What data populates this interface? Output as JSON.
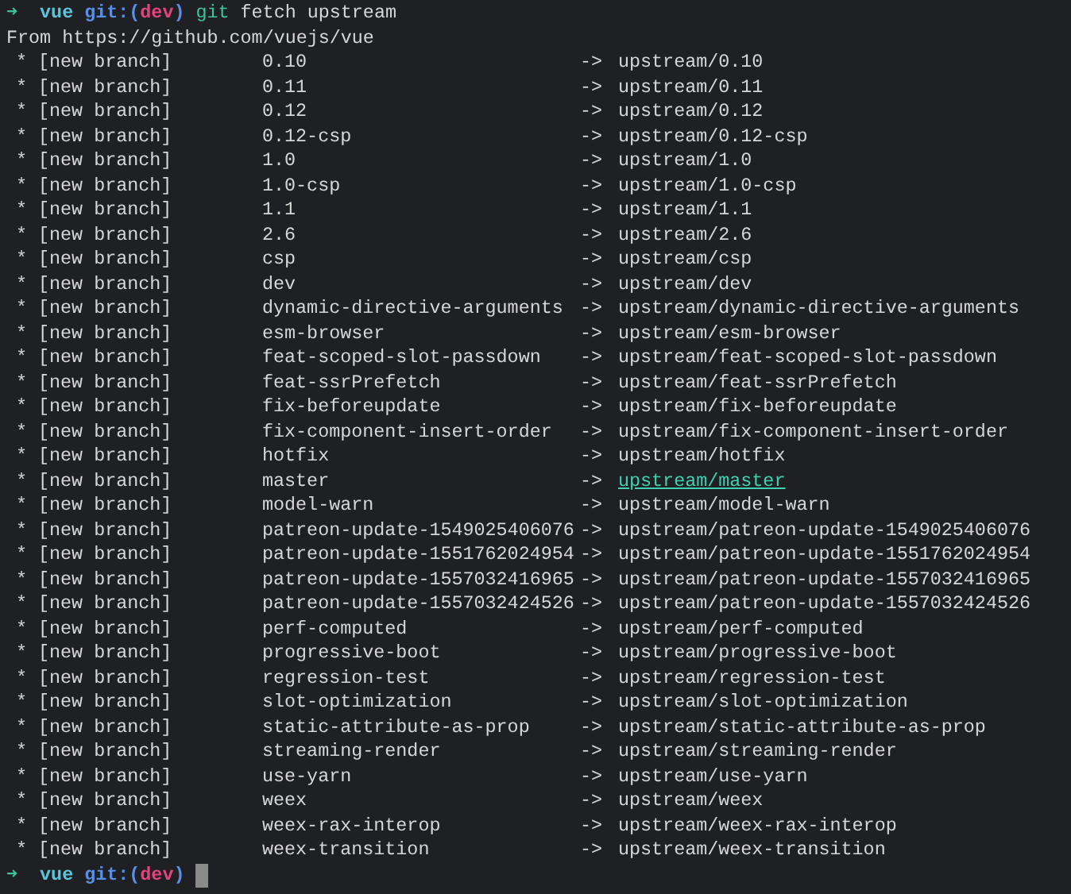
{
  "prompt_top": {
    "arrow": "➜",
    "repo": "vue",
    "git": "git:(",
    "branch": "dev",
    "close": ")",
    "command": "git",
    "args": "fetch upstream"
  },
  "from_line": "From https://github.com/vuejs/vue",
  "rows": [
    {
      "star": "*",
      "flag": "[new branch]",
      "name": "0.10",
      "arrow": "->",
      "remote": "upstream/0.10",
      "highlighted": false
    },
    {
      "star": "*",
      "flag": "[new branch]",
      "name": "0.11",
      "arrow": "->",
      "remote": "upstream/0.11",
      "highlighted": false
    },
    {
      "star": "*",
      "flag": "[new branch]",
      "name": "0.12",
      "arrow": "->",
      "remote": "upstream/0.12",
      "highlighted": false
    },
    {
      "star": "*",
      "flag": "[new branch]",
      "name": "0.12-csp",
      "arrow": "->",
      "remote": "upstream/0.12-csp",
      "highlighted": false
    },
    {
      "star": "*",
      "flag": "[new branch]",
      "name": "1.0",
      "arrow": "->",
      "remote": "upstream/1.0",
      "highlighted": false
    },
    {
      "star": "*",
      "flag": "[new branch]",
      "name": "1.0-csp",
      "arrow": "->",
      "remote": "upstream/1.0-csp",
      "highlighted": false
    },
    {
      "star": "*",
      "flag": "[new branch]",
      "name": "1.1",
      "arrow": "->",
      "remote": "upstream/1.1",
      "highlighted": false
    },
    {
      "star": "*",
      "flag": "[new branch]",
      "name": "2.6",
      "arrow": "->",
      "remote": "upstream/2.6",
      "highlighted": false
    },
    {
      "star": "*",
      "flag": "[new branch]",
      "name": "csp",
      "arrow": "->",
      "remote": "upstream/csp",
      "highlighted": false
    },
    {
      "star": "*",
      "flag": "[new branch]",
      "name": "dev",
      "arrow": "->",
      "remote": "upstream/dev",
      "highlighted": false
    },
    {
      "star": "*",
      "flag": "[new branch]",
      "name": "dynamic-directive-arguments",
      "arrow": "->",
      "remote": "upstream/dynamic-directive-arguments",
      "highlighted": false
    },
    {
      "star": "*",
      "flag": "[new branch]",
      "name": "esm-browser",
      "arrow": "->",
      "remote": "upstream/esm-browser",
      "highlighted": false
    },
    {
      "star": "*",
      "flag": "[new branch]",
      "name": "feat-scoped-slot-passdown",
      "arrow": "->",
      "remote": "upstream/feat-scoped-slot-passdown",
      "highlighted": false
    },
    {
      "star": "*",
      "flag": "[new branch]",
      "name": "feat-ssrPrefetch",
      "arrow": "->",
      "remote": "upstream/feat-ssrPrefetch",
      "highlighted": false
    },
    {
      "star": "*",
      "flag": "[new branch]",
      "name": "fix-beforeupdate",
      "arrow": "->",
      "remote": "upstream/fix-beforeupdate",
      "highlighted": false
    },
    {
      "star": "*",
      "flag": "[new branch]",
      "name": "fix-component-insert-order",
      "arrow": "->",
      "remote": "upstream/fix-component-insert-order",
      "highlighted": false
    },
    {
      "star": "*",
      "flag": "[new branch]",
      "name": "hotfix",
      "arrow": "->",
      "remote": "upstream/hotfix",
      "highlighted": false
    },
    {
      "star": "*",
      "flag": "[new branch]",
      "name": "master",
      "arrow": "->",
      "remote": "upstream/master",
      "highlighted": true
    },
    {
      "star": "*",
      "flag": "[new branch]",
      "name": "model-warn",
      "arrow": "->",
      "remote": "upstream/model-warn",
      "highlighted": false
    },
    {
      "star": "*",
      "flag": "[new branch]",
      "name": "patreon-update-1549025406076",
      "arrow": "->",
      "remote": "upstream/patreon-update-1549025406076",
      "highlighted": false
    },
    {
      "star": "*",
      "flag": "[new branch]",
      "name": "patreon-update-1551762024954",
      "arrow": "->",
      "remote": "upstream/patreon-update-1551762024954",
      "highlighted": false
    },
    {
      "star": "*",
      "flag": "[new branch]",
      "name": "patreon-update-1557032416965",
      "arrow": "->",
      "remote": "upstream/patreon-update-1557032416965",
      "highlighted": false
    },
    {
      "star": "*",
      "flag": "[new branch]",
      "name": "patreon-update-1557032424526",
      "arrow": "->",
      "remote": "upstream/patreon-update-1557032424526",
      "highlighted": false
    },
    {
      "star": "*",
      "flag": "[new branch]",
      "name": "perf-computed",
      "arrow": "->",
      "remote": "upstream/perf-computed",
      "highlighted": false
    },
    {
      "star": "*",
      "flag": "[new branch]",
      "name": "progressive-boot",
      "arrow": "->",
      "remote": "upstream/progressive-boot",
      "highlighted": false
    },
    {
      "star": "*",
      "flag": "[new branch]",
      "name": "regression-test",
      "arrow": "->",
      "remote": "upstream/regression-test",
      "highlighted": false
    },
    {
      "star": "*",
      "flag": "[new branch]",
      "name": "slot-optimization",
      "arrow": "->",
      "remote": "upstream/slot-optimization",
      "highlighted": false
    },
    {
      "star": "*",
      "flag": "[new branch]",
      "name": "static-attribute-as-prop",
      "arrow": "->",
      "remote": "upstream/static-attribute-as-prop",
      "highlighted": false
    },
    {
      "star": "*",
      "flag": "[new branch]",
      "name": "streaming-render",
      "arrow": "->",
      "remote": "upstream/streaming-render",
      "highlighted": false
    },
    {
      "star": "*",
      "flag": "[new branch]",
      "name": "use-yarn",
      "arrow": "->",
      "remote": "upstream/use-yarn",
      "highlighted": false
    },
    {
      "star": "*",
      "flag": "[new branch]",
      "name": "weex",
      "arrow": "->",
      "remote": "upstream/weex",
      "highlighted": false
    },
    {
      "star": "*",
      "flag": "[new branch]",
      "name": "weex-rax-interop",
      "arrow": "->",
      "remote": "upstream/weex-rax-interop",
      "highlighted": false
    },
    {
      "star": "*",
      "flag": "[new branch]",
      "name": "weex-transition",
      "arrow": "->",
      "remote": "upstream/weex-transition",
      "highlighted": false
    }
  ],
  "prompt_bottom": {
    "arrow": "➜",
    "repo": "vue",
    "git": "git:(",
    "branch": "dev",
    "close": ")"
  }
}
